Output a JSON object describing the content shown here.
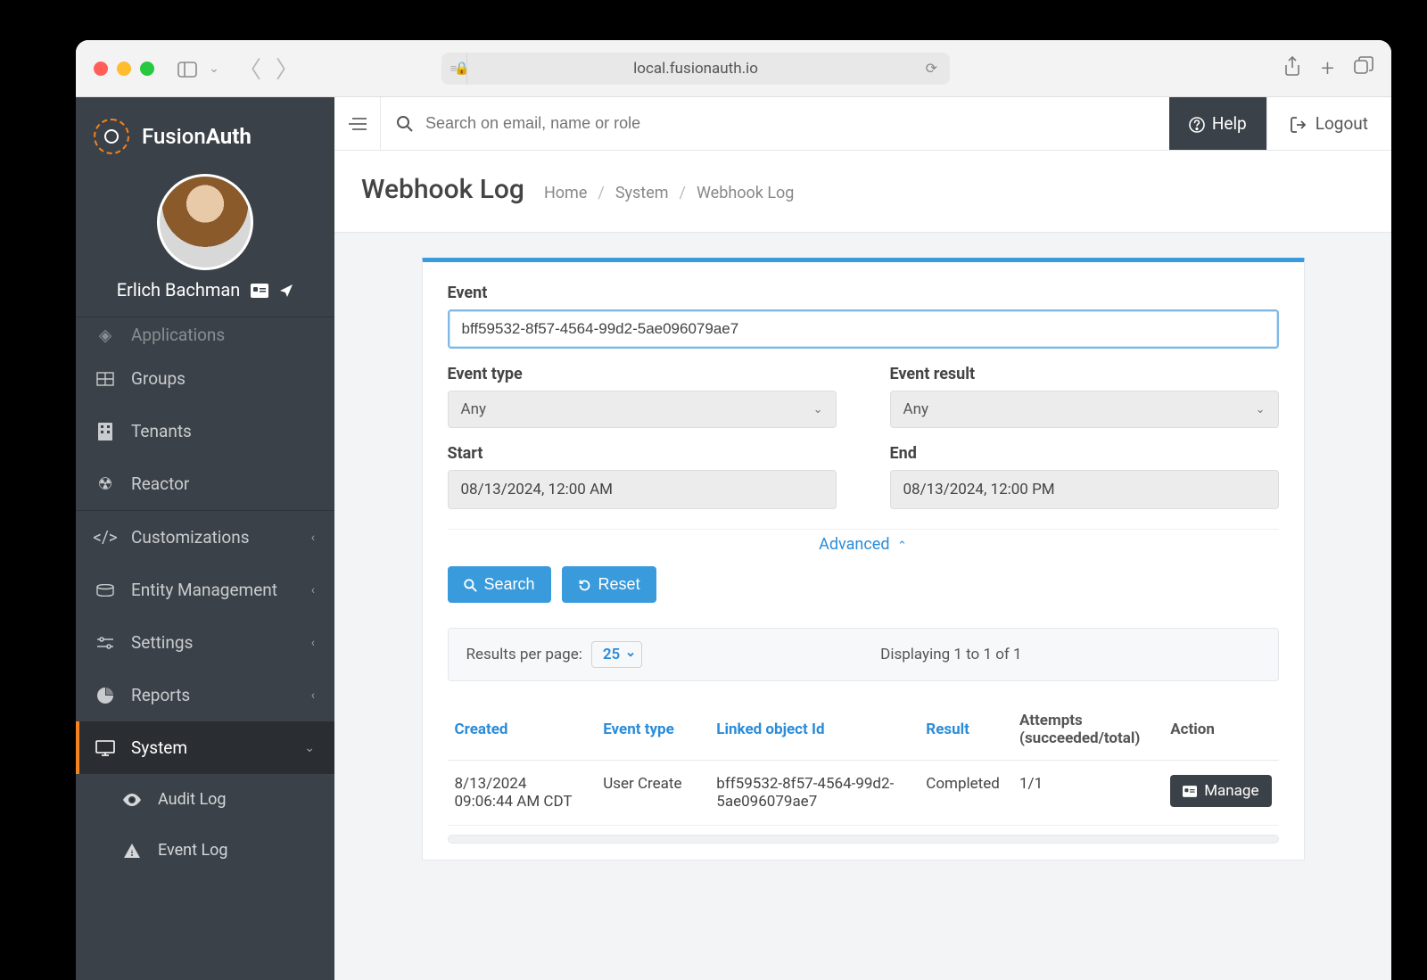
{
  "browser": {
    "url": "local.fusionauth.io"
  },
  "brand": {
    "name_light": "Fusion",
    "name_bold": "Auth"
  },
  "user": {
    "name": "Erlich Bachman"
  },
  "topbar": {
    "search_placeholder": "Search on email, name or role",
    "help": "Help",
    "logout": "Logout"
  },
  "sidebar": {
    "items": [
      {
        "icon": "applications-icon",
        "label": "Applications"
      },
      {
        "icon": "groups-icon",
        "label": "Groups"
      },
      {
        "icon": "tenants-icon",
        "label": "Tenants"
      },
      {
        "icon": "reactor-icon",
        "label": "Reactor"
      },
      {
        "icon": "code-icon",
        "label": "Customizations",
        "expandable": true
      },
      {
        "icon": "entity-icon",
        "label": "Entity Management",
        "expandable": true
      },
      {
        "icon": "settings-icon",
        "label": "Settings",
        "expandable": true
      },
      {
        "icon": "reports-icon",
        "label": "Reports",
        "expandable": true
      },
      {
        "icon": "system-icon",
        "label": "System",
        "expandable": true,
        "active": true
      }
    ],
    "system_children": [
      {
        "icon": "eye-icon",
        "label": "Audit Log"
      },
      {
        "icon": "warning-icon",
        "label": "Event Log"
      }
    ]
  },
  "page": {
    "title": "Webhook Log",
    "breadcrumb": [
      "Home",
      "System",
      "Webhook Log"
    ]
  },
  "filters": {
    "event_label": "Event",
    "event_value": "bff59532-8f57-4564-99d2-5ae096079ae7",
    "event_type_label": "Event type",
    "event_type_value": "Any",
    "event_result_label": "Event result",
    "event_result_value": "Any",
    "start_label": "Start",
    "start_value": "08/13/2024, 12:00 AM",
    "end_label": "End",
    "end_value": "08/13/2024, 12:00 PM",
    "advanced": "Advanced",
    "search_btn": "Search",
    "reset_btn": "Reset"
  },
  "results": {
    "per_page_label": "Results per page:",
    "per_page_value": "25",
    "displaying": "Displaying 1 to 1 of 1",
    "columns": {
      "created": "Created",
      "event_type": "Event type",
      "linked": "Linked object Id",
      "result": "Result",
      "attempts": "Attempts (succeeded/total)",
      "action": "Action"
    },
    "rows": [
      {
        "created_line1": "8/13/2024",
        "created_line2": "09:06:44 AM CDT",
        "event_type": "User Create",
        "linked_line1": "bff59532-8f57-4564-99d2-",
        "linked_line2": "5ae096079ae7",
        "result": "Completed",
        "attempts": "1/1",
        "action": "Manage"
      }
    ]
  }
}
